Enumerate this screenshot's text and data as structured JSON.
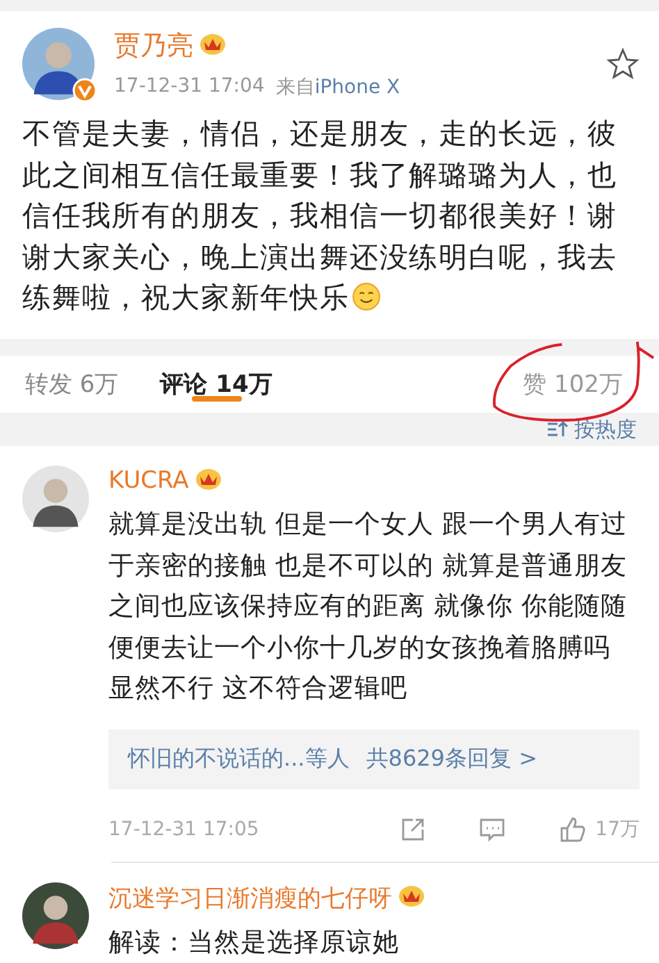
{
  "post": {
    "author": {
      "name": "贾乃亮",
      "vip": true,
      "verified": true
    },
    "time": "17-12-31 17:04",
    "source_label": "来自",
    "source": "iPhone X",
    "starred": false,
    "text": "不管是夫妻，情侣，还是朋友，走的长远，彼此之间相互信任最重要！我了解璐璐为人，也信任我所有的朋友，我相信一切都很美好！谢谢大家关心，晚上演出舞还没练明白呢，我去练舞啦，祝大家新年快乐",
    "ends_with_smiley": true
  },
  "tabs": [
    {
      "label": "转发",
      "count": "6万",
      "selected": false
    },
    {
      "label": "评论",
      "count": "14万",
      "selected": true
    }
  ],
  "likes": {
    "label": "赞",
    "count": "102万",
    "circled": true
  },
  "sort": {
    "label": "按热度"
  },
  "comments": [
    {
      "name": "KUCRA",
      "vip": true,
      "text": "就算是没出轨 但是一个女人 跟一个男人有过于亲密的接触 也是不可以的 就算是普通朋友之间也应该保持应有的距离 就像你 你能随随便便去让一个小你十几岁的女孩挽着胳膊吗显然不行 这不符合逻辑吧",
      "replies": {
        "names": "怀旧的不说话的...等人",
        "count": "共8629条回复",
        "arrow": ">"
      },
      "time": "17-12-31 17:05",
      "likes": "17万"
    },
    {
      "name": "沉迷学习日渐消瘦的七仔呀",
      "vip": true,
      "text": "解读：当然是选择原谅她"
    }
  ]
}
